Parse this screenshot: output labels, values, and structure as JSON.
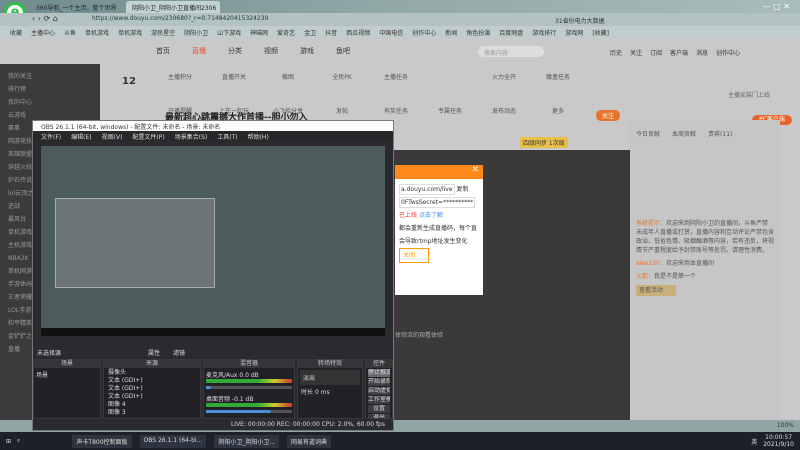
{
  "browser": {
    "tabs": [
      "360导航_一个主页，整个世界",
      "阴阳小卫_阴阳小卫直播间2306"
    ],
    "url": "https://www.douyu.com/230680?_r=0.7148420415324239",
    "search_hint": "31省份电力大数据",
    "bookmarks": [
      "收藏",
      "主播中心",
      "斗鱼",
      "单机游戏",
      "单机游戏",
      "游民星空",
      "阴阳小卫",
      "山下游戏",
      "神喵网",
      "爱奇艺",
      "金卫",
      "抖音",
      "西瓜视频",
      "中国电信",
      "创作中心",
      "新闻",
      "角色扮演",
      "百度网盘",
      "游戏排行",
      "游戏网",
      "[收藏]"
    ]
  },
  "site": {
    "nav": [
      "首页",
      "直播",
      "分类",
      "视频",
      "游戏",
      "鱼吧"
    ],
    "search_placeholder": "搜索内容",
    "top_icons": [
      "历史",
      "关注",
      "订阅",
      "客户端",
      "消息",
      "创作中心"
    ],
    "tools": [
      "主播积分",
      "直播开关",
      "截图",
      "全民PK",
      "主播任务",
      "",
      "火力全开",
      "魔盒任务",
      "开播提醒",
      "上车一起玩",
      "小飞船分享",
      "发帖",
      "有奖任务",
      "专属任务",
      "发布动态",
      "更多"
    ],
    "score": "12",
    "pc_button": "PC客户端",
    "pc_sub": "主播安装门上线",
    "title": "最新超心跳震撼大作首播--胆小勿入",
    "follow": "关注",
    "rank_badge": "四级同步 1次级",
    "sidebar": [
      "我的关注",
      "排行榜",
      "我的中心",
      "云游戏",
      "赛事",
      "网游竞技",
      "英雄联盟",
      "穿越火线",
      "炉石传说",
      "lol云顶之...",
      "逆战",
      "暴风台",
      "单机游戏",
      "主机游戏",
      "NBA2K",
      "单机网游",
      "手游休闲",
      "王者荣耀",
      "LOL手游",
      "和平精英",
      "金铲铲之...",
      "直播"
    ],
    "chat_tabs": [
      "今日贡献",
      "本周贡献",
      "贵宾(11)"
    ],
    "chat": [
      {
        "user": "系统提示",
        "text": "欢迎来到阴阳小卫的直播间，斗鱼严禁未成年人直播或打赏，直播内容和互动评论严禁包含政治、低俗色情、吸烟酗酒等内容，若有违反，将视情节严重程度给予封禁账号等处罚。请理性消费。"
      },
      {
        "user": "alex130",
        "text": "欢迎来到本直播间"
      },
      {
        "user": "火箭",
        "text": "我是不是第一个"
      }
    ],
    "chat_button": "查看活动"
  },
  "obs": {
    "title": "OBS 26.1.1 (64-bit, windows) - 配置文件: 未命名 - 场景: 未命名",
    "menu": [
      "文件(F)",
      "编辑(E)",
      "视图(V)",
      "配置文件(P)",
      "场景集合(S)",
      "工具(T)",
      "帮助(H)"
    ],
    "no_source": "未选择源",
    "props": "属性",
    "filters": "滤镜",
    "docks": {
      "scenes": "场景",
      "sources": "来源",
      "mixer": "混音器",
      "transitions": "转场特效",
      "controls": "控件"
    },
    "scene_items": [
      "场景"
    ],
    "source_items": [
      "摄像头",
      "文本 (GDI+)",
      "文本 (GDI+)",
      "文本 (GDI+)",
      "图像 4",
      "图像 3"
    ],
    "mixer": [
      {
        "name": "麦克风/Aux",
        "db": "0.0 dB",
        "level": 0.05
      },
      {
        "name": "桌面音频",
        "db": "-0.1 dB",
        "level": 0.75
      }
    ],
    "transition": "淡出",
    "duration_label": "时长",
    "duration": "0 ms",
    "controls": [
      "停止推流",
      "开始录制",
      "启动虚拟摄像机",
      "工作室模式",
      "设置",
      "退出"
    ],
    "statusbar": "LIVE: 00:00:00  REC: 00:00:00  CPU: 2.0%, 60.00 fps"
  },
  "dialog": {
    "url": "a.douyu.com/live",
    "key": "0FTwsSecret=**********",
    "copy": "复制",
    "note1": "已上线",
    "link": "点击了解",
    "note2": "都会重新生成直播码，每个直",
    "note3": "会导致rtmp地址发生变化",
    "close": "关闭",
    "footer": "体验流的观看体验"
  },
  "taskbar": {
    "items": [
      "声卡T800控制面板",
      "OBS 26.1.1 (64-bi...",
      "阴阳小卫_阴阳小卫...",
      "网易有道词典"
    ],
    "time": "10:00:57",
    "date": "2021/9/10",
    "ime": "英",
    "zoom": "100%"
  }
}
